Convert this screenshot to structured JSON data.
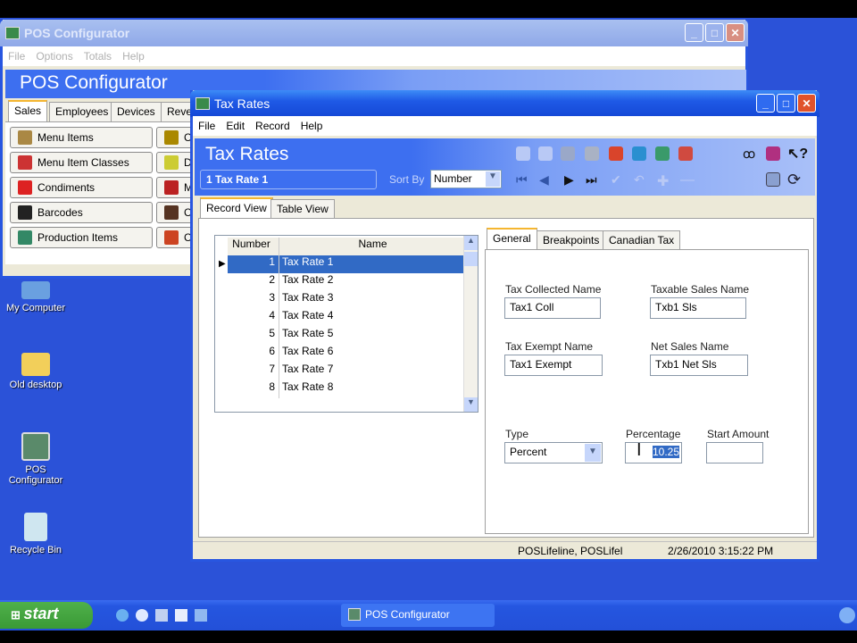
{
  "background_window": {
    "title": "POS Configurator",
    "menu": [
      "File",
      "Options",
      "Totals",
      "Help"
    ],
    "banner_title": "POS Configurator",
    "tabs": [
      "Sales",
      "Employees",
      "Devices",
      "Reve"
    ],
    "buttons": [
      "Menu Items",
      "Menu Item Classes",
      "Condiments",
      "Barcodes",
      "Production Items"
    ],
    "buttons_col2": [
      "C",
      "D",
      "M",
      "C",
      "C"
    ]
  },
  "tax_window": {
    "title": "Tax Rates",
    "menu": [
      "File",
      "Edit",
      "Record",
      "Help"
    ],
    "banner_title": "Tax Rates",
    "current_record": "1 Tax Rate 1",
    "sort_by_label": "Sort By",
    "sort_by_value": "Number",
    "view_tabs": [
      "Record View",
      "Table View"
    ],
    "grid": {
      "columns": [
        "Number",
        "Name"
      ],
      "rows": [
        {
          "number": "1",
          "name": "Tax Rate 1"
        },
        {
          "number": "2",
          "name": "Tax Rate 2"
        },
        {
          "number": "3",
          "name": "Tax Rate 3"
        },
        {
          "number": "4",
          "name": "Tax Rate 4"
        },
        {
          "number": "5",
          "name": "Tax Rate 5"
        },
        {
          "number": "6",
          "name": "Tax Rate 6"
        },
        {
          "number": "7",
          "name": "Tax Rate 7"
        },
        {
          "number": "8",
          "name": "Tax Rate 8"
        }
      ]
    },
    "detail_tabs": [
      "General",
      "Breakpoints",
      "Canadian Tax"
    ],
    "fields": {
      "tax_collected_name": {
        "label": "Tax Collected Name",
        "value": "Tax1 Coll"
      },
      "taxable_sales_name": {
        "label": "Taxable Sales Name",
        "value": "Txb1 Sls"
      },
      "tax_exempt_name": {
        "label": "Tax Exempt Name",
        "value": "Tax1 Exempt"
      },
      "net_sales_name": {
        "label": "Net Sales Name",
        "value": "Txb1 Net Sls"
      },
      "type": {
        "label": "Type",
        "value": "Percent"
      },
      "percentage": {
        "label": "Percentage",
        "value": "10.25"
      },
      "start_amount": {
        "label": "Start Amount",
        "value": ""
      }
    },
    "status": {
      "user": "POSLifeline, POSLifel",
      "datetime": "2/26/2010 3:15:22 PM"
    }
  },
  "desktop_icons": [
    "My Computer",
    "Old desktop",
    "POS Configurator",
    "Recycle Bin"
  ],
  "taskbar": {
    "start": "start",
    "task": "POS Configurator"
  }
}
